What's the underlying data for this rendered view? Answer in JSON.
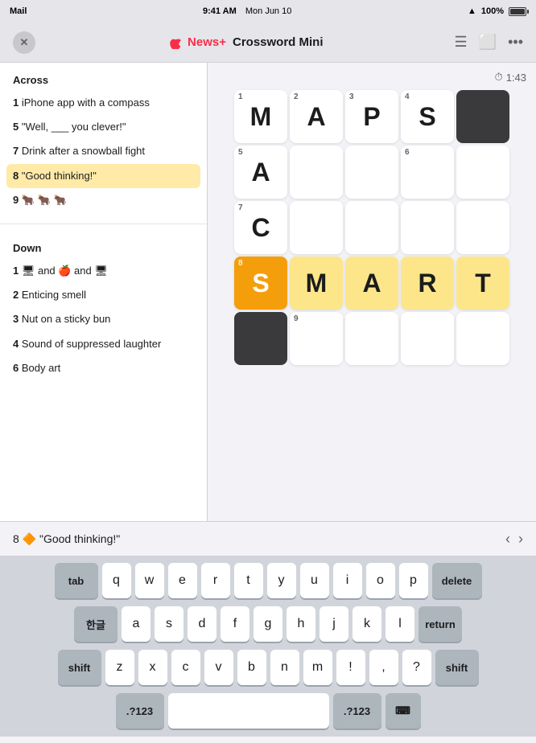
{
  "statusBar": {
    "carrier": "Mail",
    "time": "9:41 AM",
    "date": "Mon Jun 10",
    "wifi": "WiFi",
    "battery": "100%"
  },
  "navBar": {
    "closeLabel": "✕",
    "logoText": "News+",
    "titleText": "Crossword Mini",
    "dotsLabel": "•••"
  },
  "timer": {
    "icon": "⏱",
    "value": "1:43"
  },
  "clues": {
    "acrossHeader": "Across",
    "acrossItems": [
      {
        "num": "1",
        "text": "iPhone app with a compass"
      },
      {
        "num": "5",
        "text": "\"Well, ___ you clever!\""
      },
      {
        "num": "7",
        "text": "Drink after a snowball fight"
      },
      {
        "num": "8",
        "text": "\"Good thinking!\"",
        "active": true
      },
      {
        "num": "9",
        "text": "🐂 🐂 🐂"
      }
    ],
    "downHeader": "Down",
    "downItems": [
      {
        "num": "1",
        "text": "🖥 and 🍎 and 🖥",
        "emoji": true
      },
      {
        "num": "2",
        "text": "Enticing smell"
      },
      {
        "num": "3",
        "text": "Nut on a sticky bun"
      },
      {
        "num": "4",
        "text": "Sound of suppressed laughter"
      },
      {
        "num": "6",
        "text": "Body art"
      }
    ]
  },
  "grid": {
    "cells": [
      {
        "row": 0,
        "col": 0,
        "letter": "M",
        "num": "1",
        "type": "normal"
      },
      {
        "row": 0,
        "col": 1,
        "letter": "A",
        "num": "2",
        "type": "normal"
      },
      {
        "row": 0,
        "col": 2,
        "letter": "P",
        "num": "3",
        "type": "normal"
      },
      {
        "row": 0,
        "col": 3,
        "letter": "S",
        "num": "4",
        "type": "normal"
      },
      {
        "row": 0,
        "col": 4,
        "letter": "",
        "num": "",
        "type": "black"
      },
      {
        "row": 1,
        "col": 0,
        "letter": "A",
        "num": "5",
        "type": "normal"
      },
      {
        "row": 1,
        "col": 1,
        "letter": "",
        "num": "",
        "type": "normal"
      },
      {
        "row": 1,
        "col": 2,
        "letter": "",
        "num": "",
        "type": "normal"
      },
      {
        "row": 1,
        "col": 3,
        "letter": "",
        "num": "6",
        "type": "normal"
      },
      {
        "row": 1,
        "col": 4,
        "letter": "",
        "num": "",
        "type": "normal"
      },
      {
        "row": 2,
        "col": 0,
        "letter": "C",
        "num": "7",
        "type": "normal"
      },
      {
        "row": 2,
        "col": 1,
        "letter": "",
        "num": "",
        "type": "normal"
      },
      {
        "row": 2,
        "col": 2,
        "letter": "",
        "num": "",
        "type": "normal"
      },
      {
        "row": 2,
        "col": 3,
        "letter": "",
        "num": "",
        "type": "normal"
      },
      {
        "row": 2,
        "col": 4,
        "letter": "",
        "num": "",
        "type": "normal"
      },
      {
        "row": 3,
        "col": 0,
        "letter": "S",
        "num": "8",
        "type": "active"
      },
      {
        "row": 3,
        "col": 1,
        "letter": "M",
        "num": "",
        "type": "highlighted"
      },
      {
        "row": 3,
        "col": 2,
        "letter": "A",
        "num": "",
        "type": "highlighted"
      },
      {
        "row": 3,
        "col": 3,
        "letter": "R",
        "num": "",
        "type": "highlighted"
      },
      {
        "row": 3,
        "col": 4,
        "letter": "T",
        "num": "",
        "type": "highlighted"
      },
      {
        "row": 4,
        "col": 0,
        "letter": "",
        "num": "",
        "type": "black"
      },
      {
        "row": 4,
        "col": 1,
        "letter": "",
        "num": "9",
        "type": "normal"
      },
      {
        "row": 4,
        "col": 2,
        "letter": "",
        "num": "",
        "type": "normal"
      },
      {
        "row": 4,
        "col": 3,
        "letter": "",
        "num": "",
        "type": "normal"
      },
      {
        "row": 4,
        "col": 4,
        "letter": "",
        "num": "",
        "type": "normal"
      }
    ]
  },
  "hintBar": {
    "text": "8 🔶 \"Good thinking!\""
  },
  "keyboard": {
    "rows": [
      [
        "tab",
        "q",
        "w",
        "e",
        "r",
        "t",
        "y",
        "u",
        "i",
        "o",
        "p",
        "delete"
      ],
      [
        "한글",
        "a",
        "s",
        "d",
        "f",
        "g",
        "h",
        "j",
        "k",
        "l",
        "return"
      ],
      [
        "shift",
        "z",
        "x",
        "c",
        "v",
        "b",
        "n",
        "m",
        "!",
        ",",
        "?",
        "shift"
      ],
      [
        ".?123",
        "",
        "",
        ".?123",
        "⌨"
      ]
    ]
  }
}
